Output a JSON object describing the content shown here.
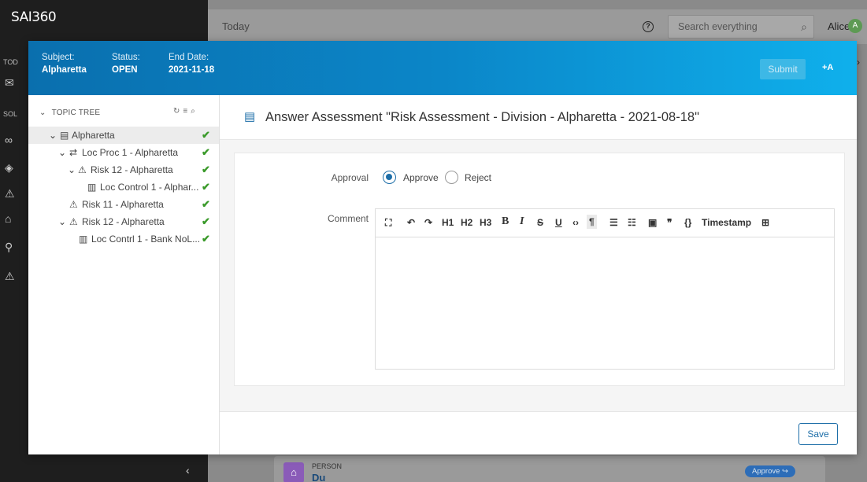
{
  "app": {
    "logo": "SAI360",
    "today_label": "Today",
    "search_placeholder": "Search everything",
    "user_name": "Alice",
    "user_initial": "A",
    "side_labels": [
      "TOD",
      "SOL"
    ],
    "background_card": {
      "label": "PERSON",
      "name": "Du",
      "badge": "Approve ↪"
    }
  },
  "modal": {
    "header": {
      "subject_label": "Subject:",
      "subject_value": "Alpharetta",
      "status_label": "Status:",
      "status_value": "OPEN",
      "end_date_label": "End Date:",
      "end_date_value": "2021-11-18",
      "submit_label": "Submit",
      "assign_icon": "+A"
    },
    "tree": {
      "heading": "TOPIC TREE",
      "items": [
        {
          "label": "Alpharetta",
          "icon": "building-icon",
          "expanded": true,
          "checked": true
        },
        {
          "label": "Loc Proc 1 - Alpharetta",
          "icon": "process-icon",
          "expanded": true,
          "checked": true
        },
        {
          "label": "Risk 12 - Alpharetta",
          "icon": "warning-icon",
          "expanded": true,
          "checked": true
        },
        {
          "label": "Loc Control 1 - Alphar...",
          "icon": "control-icon",
          "expanded": false,
          "checked": true
        },
        {
          "label": "Risk 11 - Alpharetta",
          "icon": "warning-icon",
          "expanded": false,
          "checked": true
        },
        {
          "label": "Risk 12 - Alpharetta",
          "icon": "warning-icon",
          "expanded": true,
          "checked": true
        },
        {
          "label": "Loc Contrl 1 - Bank NoL...",
          "icon": "control-icon",
          "expanded": false,
          "checked": true
        }
      ]
    },
    "content": {
      "title": "Answer Assessment \"Risk Assessment - Division - Alpharetta - 2021-08-18\"",
      "approval_label": "Approval",
      "approve_label": "Approve",
      "reject_label": "Reject",
      "approval_selected": "Approve",
      "comment_label": "Comment",
      "toolbar": {
        "h1": "H1",
        "h2": "H2",
        "h3": "H3",
        "bold": "B",
        "timestamp": "Timestamp"
      },
      "comment_value": "",
      "save_label": "Save"
    }
  },
  "colors": {
    "header_gradient_start": "#0a6fae",
    "header_gradient_end": "#0fb0ec",
    "accent": "#1d6ea8",
    "check": "#3a9a2a"
  }
}
